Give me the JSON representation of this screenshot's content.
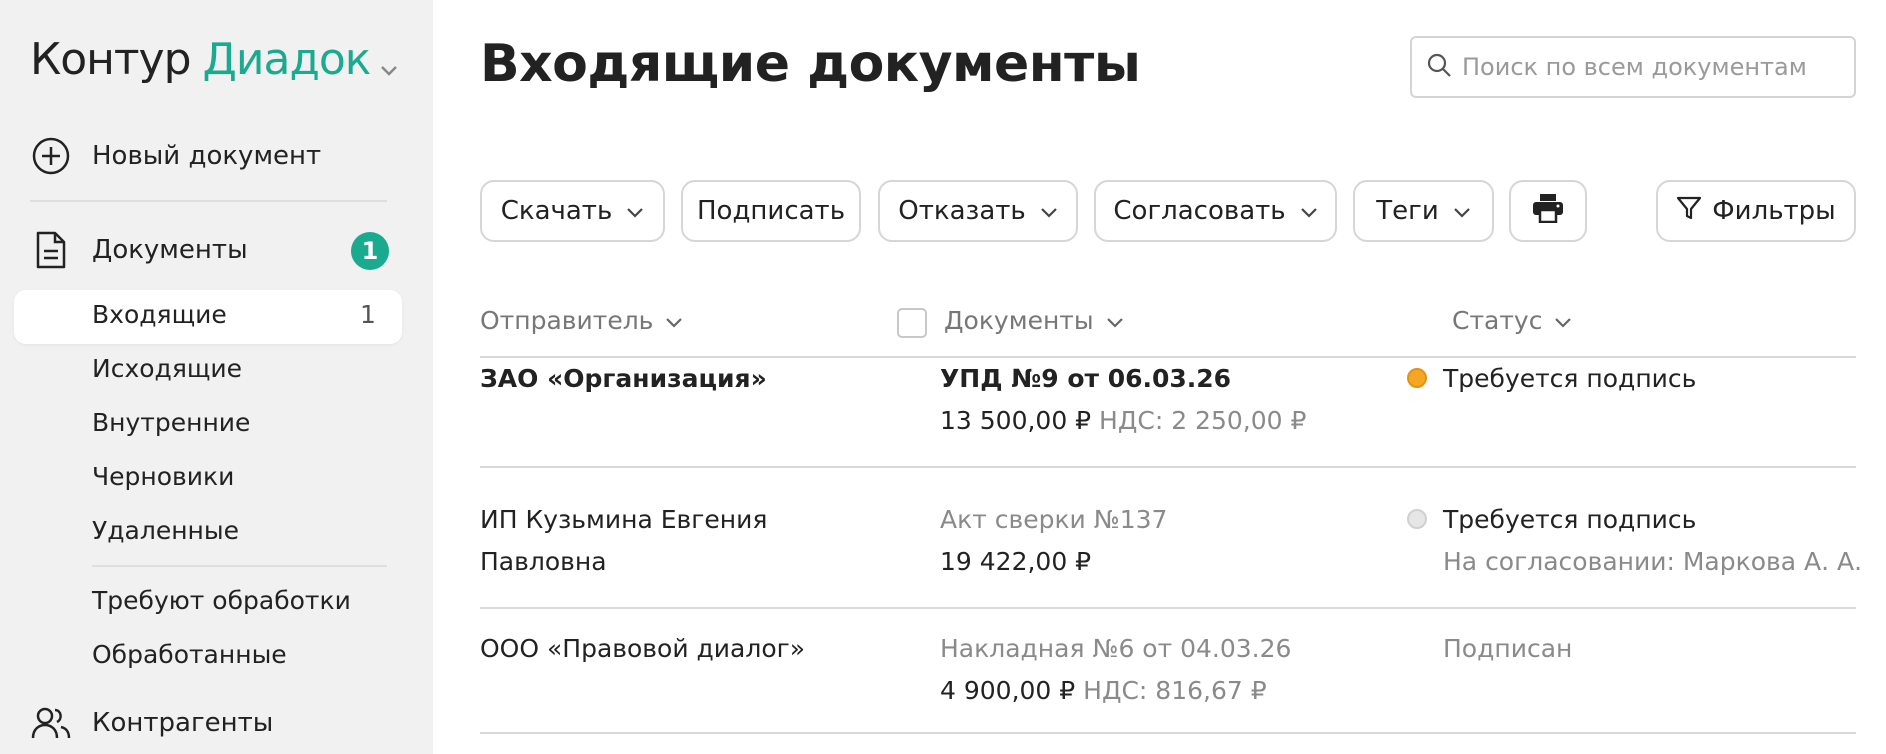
{
  "app": {
    "brand_part1": "Контур",
    "brand_part2": "Диадок",
    "accent_color": "#1aaa8f"
  },
  "sidebar": {
    "new_document": "Новый документ",
    "documents": {
      "label": "Документы",
      "badge": "1"
    },
    "items": [
      {
        "label": "Входящие",
        "count": "1",
        "active": true
      },
      {
        "label": "Исходящие"
      },
      {
        "label": "Внутренние"
      },
      {
        "label": "Черновики"
      },
      {
        "label": "Удаленные"
      }
    ],
    "filters": [
      {
        "label": "Требуют обработки"
      },
      {
        "label": "Обработанные"
      }
    ],
    "contractors": "Контрагенты"
  },
  "page": {
    "title": "Входящие документы",
    "search_placeholder": "Поиск по всем документам"
  },
  "toolbar": {
    "download": "Скачать",
    "sign": "Подписать",
    "reject": "Отказать",
    "approve": "Согласовать",
    "tags": "Теги",
    "filters": "Фильтры"
  },
  "table": {
    "headers": {
      "sender": "Отправитель",
      "documents": "Документы",
      "status": "Статус"
    },
    "rows": [
      {
        "sender": "ЗАО «Организация»",
        "sender_line2": "",
        "doc_title": "УПД №9 от 06.03.26",
        "amount": "13 500,00 ₽",
        "vat": "НДС: 2 250,00 ₽",
        "status": "Требуется подпись",
        "status_sub": "",
        "status_color": "#f5a623"
      },
      {
        "sender": "ИП Кузьмина Евгения",
        "sender_line2": "Павловна",
        "doc_title": "Акт сверки №137",
        "amount": "19 422,00 ₽",
        "vat": "",
        "status": "Требуется подпись",
        "status_sub": "На согласовании: Маркова А. А.",
        "status_color": "#e0e0e0"
      },
      {
        "sender": "ООО «Правовой диалог»",
        "sender_line2": "",
        "doc_title": "Накладная №6 от 04.03.26",
        "amount": "4 900,00 ₽",
        "vat": "НДС: 816,67 ₽",
        "status": "Подписан",
        "status_sub": "",
        "status_color": ""
      }
    ]
  }
}
